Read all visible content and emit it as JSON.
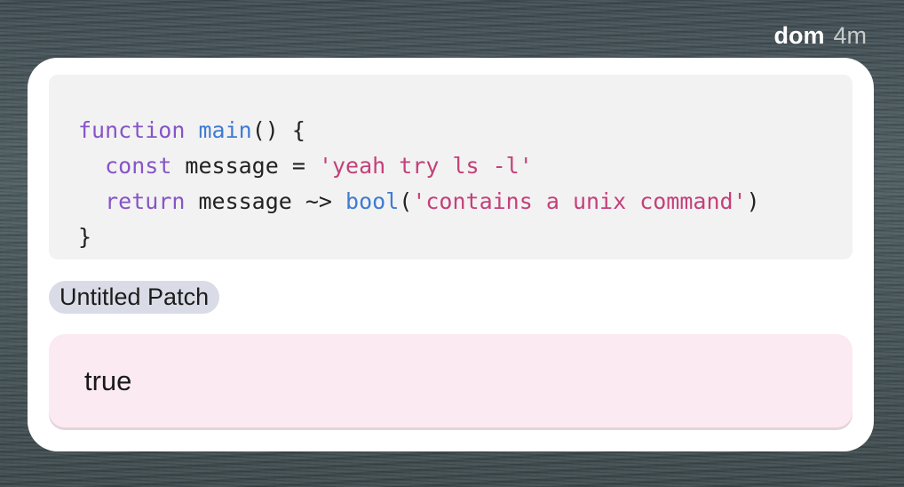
{
  "message": {
    "author": "dom",
    "time": "4m"
  },
  "code": {
    "l1": {
      "t1": "function",
      "t2": " ",
      "t3": "main",
      "t4": "() {"
    },
    "l2": {
      "t1": "  ",
      "t2": "const",
      "t3": " message = ",
      "t4": "'yeah try ls -l'"
    },
    "l3": {
      "t1": "  ",
      "t2": "return",
      "t3": " message ~> ",
      "t4": "bool",
      "t5": "(",
      "t6": "'contains a unix command'",
      "t7": ")"
    },
    "l4": {
      "t1": "}"
    }
  },
  "patch": {
    "label": "Untitled Patch"
  },
  "result": {
    "value": "true"
  },
  "colors": {
    "keyword": "#8655c7",
    "function": "#3f7bd4",
    "string": "#c4407a",
    "result_bg": "#fbeaf1",
    "tag_bg": "#d9dce6",
    "code_bg": "#f2f2f2"
  }
}
